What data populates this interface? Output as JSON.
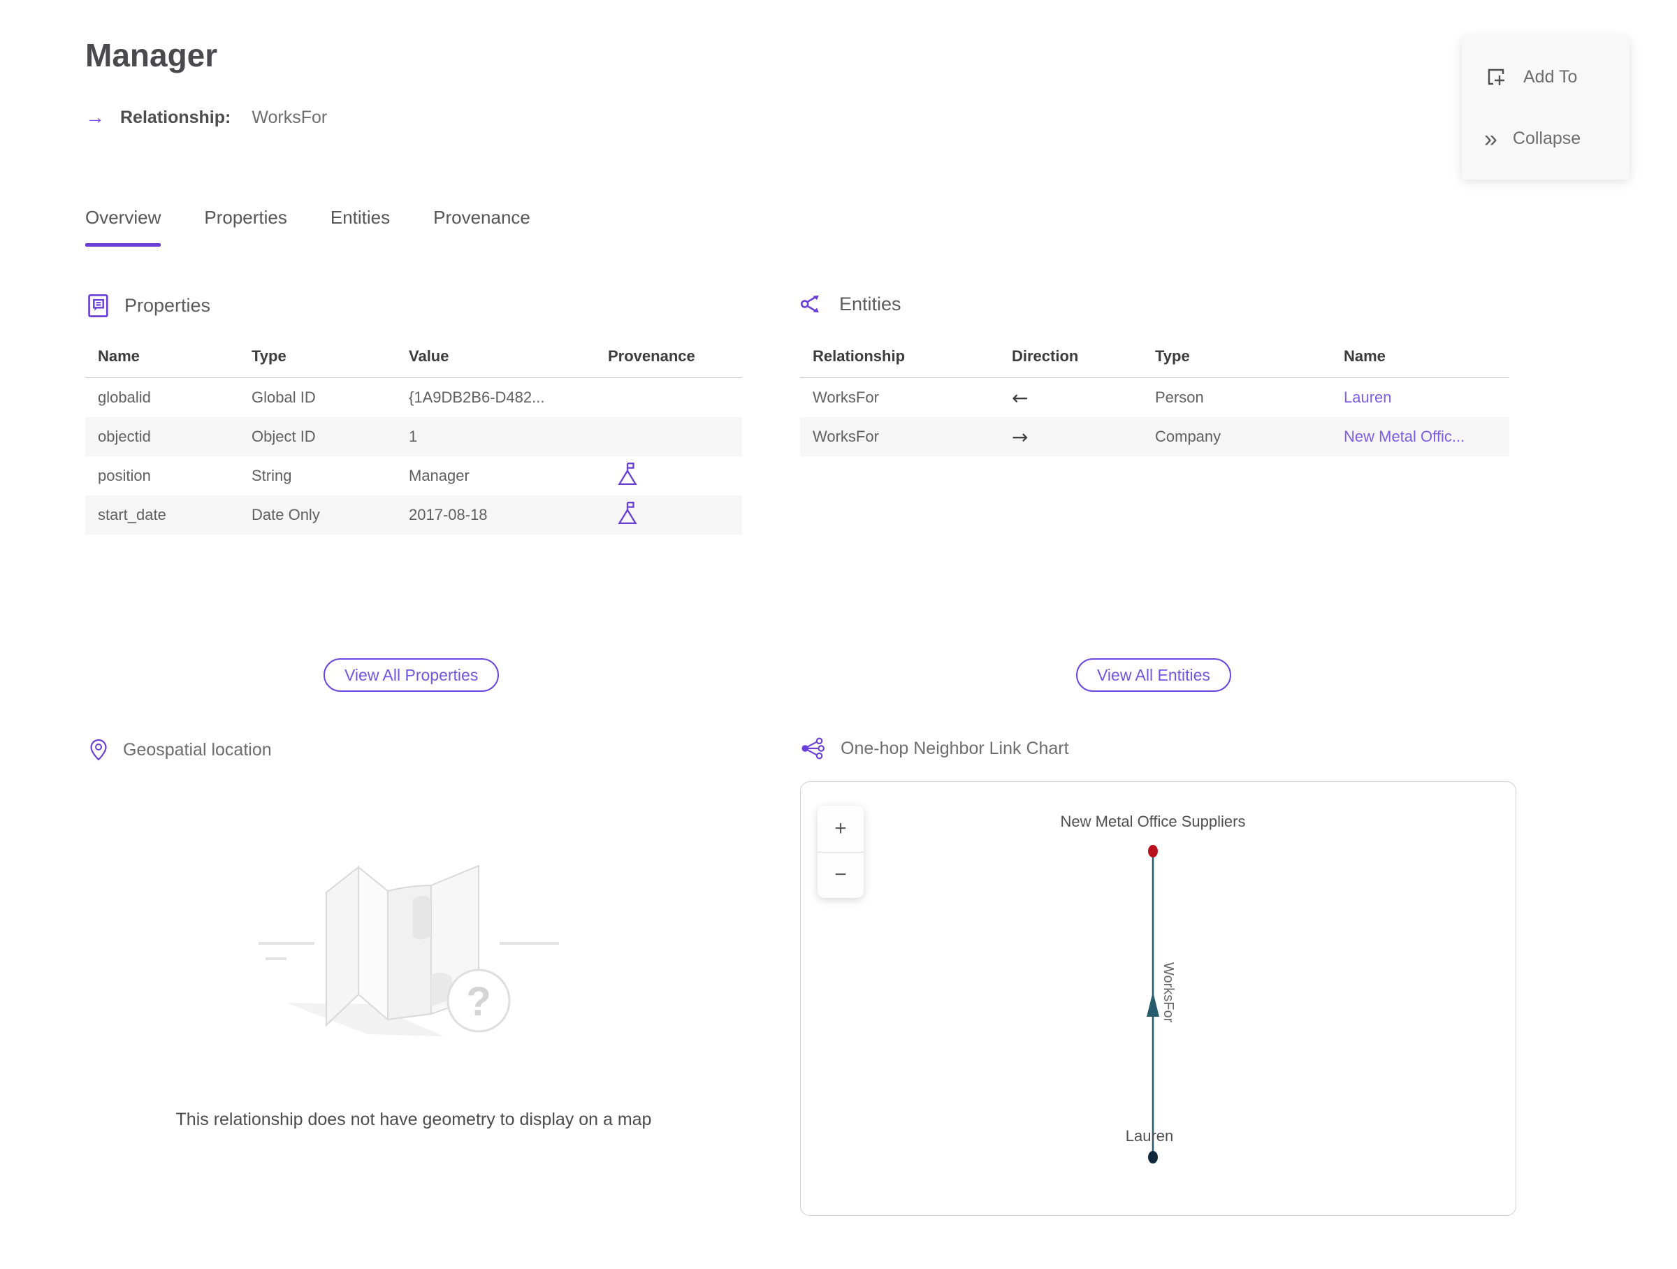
{
  "header": {
    "title": "Manager",
    "arrow": "→",
    "subtitle_label": "Relationship:",
    "subtitle_value": "WorksFor"
  },
  "actions": {
    "add_to": "Add To",
    "collapse": "Collapse",
    "collapse_glyph": "»"
  },
  "tabs": [
    {
      "label": "Overview",
      "active": true
    },
    {
      "label": "Properties",
      "active": false
    },
    {
      "label": "Entities",
      "active": false
    },
    {
      "label": "Provenance",
      "active": false
    }
  ],
  "properties_section": {
    "title": "Properties",
    "columns": [
      "Name",
      "Type",
      "Value",
      "Provenance"
    ],
    "rows": [
      {
        "name": "globalid",
        "type": "Global ID",
        "value": "{1A9DB2B6-D482...",
        "provenance": false
      },
      {
        "name": "objectid",
        "type": "Object ID",
        "value": "1",
        "provenance": false
      },
      {
        "name": "position",
        "type": "String",
        "value": "Manager",
        "provenance": true
      },
      {
        "name": "start_date",
        "type": "Date Only",
        "value": "2017-08-18",
        "provenance": true
      }
    ],
    "view_all_label": "View All Properties"
  },
  "entities_section": {
    "title": "Entities",
    "columns": [
      "Relationship",
      "Direction",
      "Type",
      "Name"
    ],
    "rows": [
      {
        "relationship": "WorksFor",
        "direction": "←",
        "type": "Person",
        "name": "Lauren"
      },
      {
        "relationship": "WorksFor",
        "direction": "→",
        "type": "Company",
        "name": "New Metal Offic..."
      }
    ],
    "view_all_label": "View All Entities"
  },
  "geospatial_section": {
    "title": "Geospatial location",
    "placeholder_glyph": "?",
    "empty_message": "This relationship does not have geometry to display on a map"
  },
  "link_chart_section": {
    "title": "One-hop Neighbor Link Chart",
    "zoom_in_label": "+",
    "zoom_out_label": "−",
    "chart": {
      "nodes": [
        {
          "label": "New Metal Office Suppliers",
          "color": "#b8111c"
        },
        {
          "label": "Lauren",
          "color": "#102a3c"
        }
      ],
      "edge": {
        "label": "WorksFor",
        "from": "Lauren",
        "to": "New Metal Office Suppliers",
        "color": "#265c6e"
      }
    }
  },
  "colors": {
    "accent_purple": "#6a3fd8",
    "link_purple": "#7c5ce6",
    "tab_underline": "#6b3fd6",
    "edge_teal": "#265c6e",
    "node_red": "#b8111c",
    "node_navy": "#102a3c",
    "row_alt_bg": "#f6f6f6"
  }
}
